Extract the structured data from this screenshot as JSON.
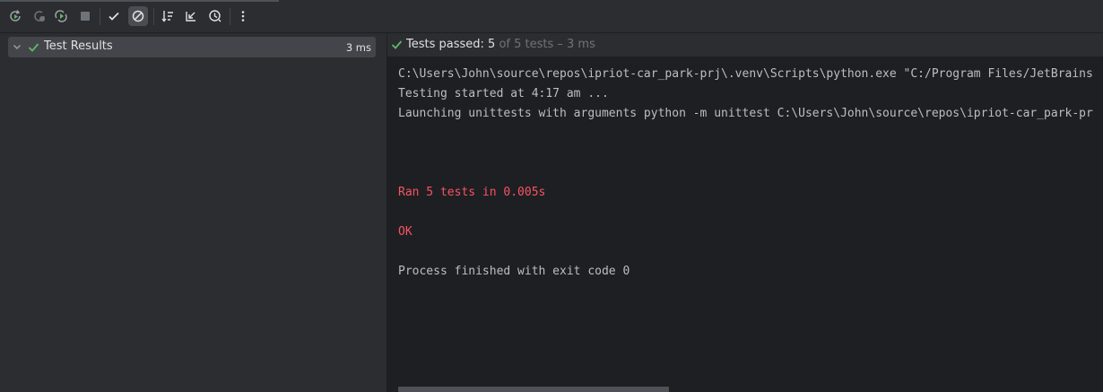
{
  "toolbar": {
    "buttons": [
      {
        "name": "rerun-icon"
      },
      {
        "name": "rerun-failed-icon"
      },
      {
        "name": "toggle-auto-test-icon"
      },
      {
        "name": "stop-icon"
      },
      {
        "name": "show-passed-icon"
      },
      {
        "name": "show-ignored-icon",
        "active": true
      },
      {
        "name": "sort-alphabetically-icon"
      },
      {
        "name": "collapse-all-icon"
      },
      {
        "name": "sort-by-duration-icon"
      },
      {
        "name": "more-options-icon"
      }
    ]
  },
  "tree": {
    "root_label": "Test Results",
    "root_duration": "3 ms"
  },
  "status": {
    "prefix": "Tests passed: ",
    "passed_count": "5",
    "of_text": " of 5 tests – 3 ms"
  },
  "console": {
    "lines": [
      {
        "text": "C:\\Users\\John\\source\\repos\\ipriot-car_park-prj\\.venv\\Scripts\\python.exe \"C:/Program Files/JetBrains",
        "kind": "normal"
      },
      {
        "text": "Testing started at 4:17 am ...",
        "kind": "normal"
      },
      {
        "text": "Launching unittests with arguments python -m unittest C:\\Users\\John\\source\\repos\\ipriot-car_park-pr",
        "kind": "normal"
      },
      {
        "text": "",
        "kind": "normal"
      },
      {
        "text": "",
        "kind": "normal"
      },
      {
        "text": "",
        "kind": "normal"
      },
      {
        "text": "Ran 5 tests in 0.005s",
        "kind": "err"
      },
      {
        "text": "",
        "kind": "normal"
      },
      {
        "text": "OK",
        "kind": "err"
      },
      {
        "text": "",
        "kind": "normal"
      },
      {
        "text": "Process finished with exit code 0",
        "kind": "normal"
      }
    ]
  },
  "colors": {
    "success": "#5fb865",
    "error_text": "#f75464"
  }
}
